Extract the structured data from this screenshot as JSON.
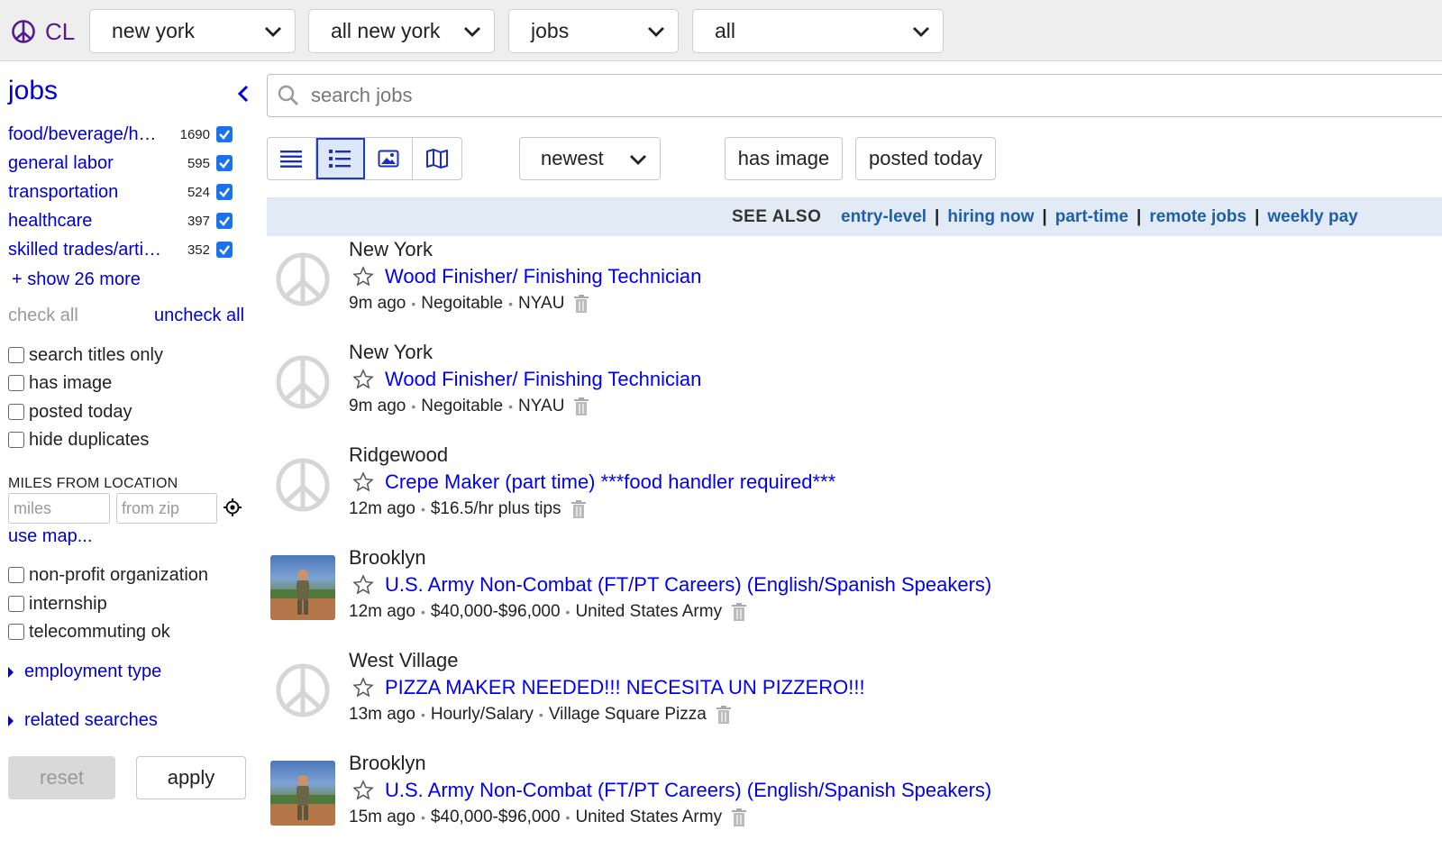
{
  "topbar": {
    "logo_text": "CL",
    "area": "new york",
    "subarea": "all new york",
    "category": "jobs",
    "subcategory": "all"
  },
  "sidebar": {
    "title": "jobs",
    "categories": [
      {
        "label": "food/beverage/h…",
        "count": "1690"
      },
      {
        "label": "general labor",
        "count": "595"
      },
      {
        "label": "transportation",
        "count": "524"
      },
      {
        "label": "healthcare",
        "count": "397"
      },
      {
        "label": "skilled trades/arti…",
        "count": "352"
      }
    ],
    "show_more": "+ show 26 more",
    "check_all": "check all",
    "uncheck_all": "uncheck all",
    "filters": [
      "search titles only",
      "has image",
      "posted today",
      "hide duplicates"
    ],
    "miles_heading": "MILES FROM LOCATION",
    "miles_placeholder": "miles",
    "zip_placeholder": "from zip",
    "use_map": "use map...",
    "extra_filters": [
      "non-profit organization",
      "internship",
      "telecommuting ok"
    ],
    "employment_type": "employment type",
    "related_searches": "related searches",
    "reset": "reset",
    "apply": "apply"
  },
  "main": {
    "search_placeholder": "search jobs",
    "sort": "newest",
    "has_image": "has image",
    "posted_today": "posted today",
    "see_also_label": "SEE ALSO",
    "see_also": [
      "entry-level",
      "hiring now",
      "part-time",
      "remote jobs",
      "weekly pay"
    ]
  },
  "posts": [
    {
      "location": "New York",
      "title": "Wood Finisher/ Finishing Technician",
      "age": "9m ago",
      "pay": "Negoitable",
      "company": "NYAU",
      "image": false
    },
    {
      "location": "New York",
      "title": "Wood Finisher/ Finishing Technician",
      "age": "9m ago",
      "pay": "Negoitable",
      "company": "NYAU",
      "image": false
    },
    {
      "location": "Ridgewood",
      "title": "Crepe Maker (part time) ***food handler required***",
      "age": "12m ago",
      "pay": "$16.5/hr plus tips",
      "company": "",
      "image": false
    },
    {
      "location": "Brooklyn",
      "title": "U.S. Army Non-Combat (FT/PT Careers) (English/Spanish Speakers)",
      "age": "12m ago",
      "pay": "$40,000-$96,000",
      "company": "United States Army",
      "image": true
    },
    {
      "location": "West Village",
      "title": "PIZZA MAKER NEEDED!!! NECESITA UN PIZZERO!!!",
      "age": "13m ago",
      "pay": "Hourly/Salary",
      "company": "Village Square Pizza",
      "image": false
    },
    {
      "location": "Brooklyn",
      "title": "U.S. Army Non-Combat (FT/PT Careers) (English/Spanish Speakers)",
      "age": "15m ago",
      "pay": "$40,000-$96,000",
      "company": "United States Army",
      "image": true
    }
  ],
  "colors": {
    "link": "#0000cc",
    "post_title": "#0000ee",
    "see_also_bg": "#e2ebf5",
    "logo": "#551a8b",
    "checkbox": "#1a73e8"
  }
}
